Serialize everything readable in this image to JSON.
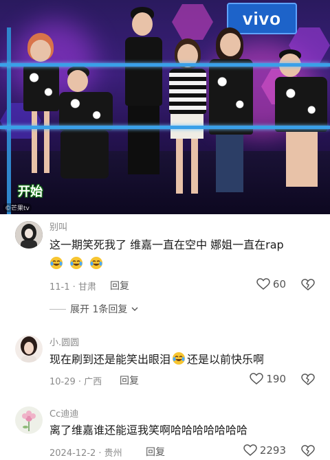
{
  "video": {
    "sign_text": "vivo",
    "caption": "开始",
    "watermark": "©芒果tv"
  },
  "comments": [
    {
      "username": "别叫",
      "text": "这一期笑死我了 维嘉一直在空中 娜姐一直在rap",
      "emoji_line": [
        "laugh-cry-emoji",
        "laugh-cry-emoji",
        "laugh-cry-emoji"
      ],
      "date_location": "11-1 · 甘肃",
      "reply_label": "回复",
      "likes": "60",
      "expand_label": "展开 1条回复"
    },
    {
      "username": "小.圆圆",
      "text_before": "现在刷到还是能笑出眼泪",
      "text_after": "还是以前快乐啊",
      "date_location": "10-29 · 广西",
      "reply_label": "回复",
      "likes": "190"
    },
    {
      "username": "Cc迪迪",
      "text": "离了维嘉谁还能逗我笑啊哈哈哈哈哈哈哈",
      "date_location": "2024-12-2 · 贵州",
      "reply_label": "回复",
      "likes": "2293"
    }
  ],
  "colors": {
    "rope": "#3aa0e8",
    "username": "#8a8a8a",
    "text": "#1a1a1a",
    "emoji_yellow": "#f7c531"
  }
}
